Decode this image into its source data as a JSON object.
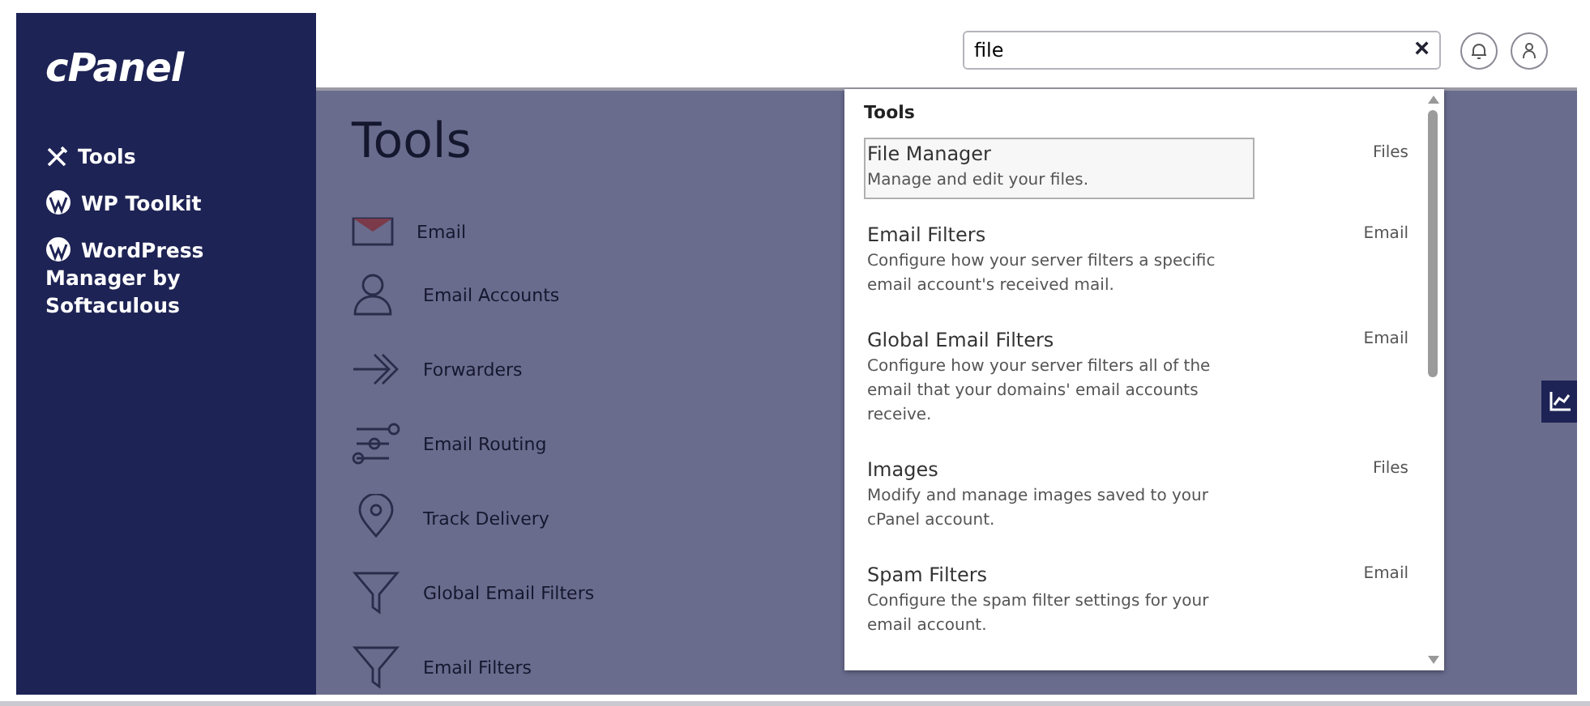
{
  "sidebar": {
    "logo": "cPanel",
    "items": [
      {
        "label": "Tools"
      },
      {
        "label": "WP Toolkit"
      },
      {
        "label": "WordPress Manager by Softaculous"
      }
    ]
  },
  "header": {
    "search": {
      "value": "file",
      "clear": "×"
    }
  },
  "page": {
    "title": "Tools",
    "tools": [
      {
        "label": "Email"
      },
      {
        "label": "Email Accounts"
      },
      {
        "label": "Forwarders"
      },
      {
        "label": "Email Routing"
      },
      {
        "label": "Track Delivery"
      },
      {
        "label": "Global Email Filters"
      },
      {
        "label": "Email Filters"
      }
    ]
  },
  "search_results": {
    "heading": "Tools",
    "items": [
      {
        "name": "File Manager",
        "description": "Manage and edit your files.",
        "category": "Files",
        "selected": true
      },
      {
        "name": "Email Filters",
        "description": "Configure how your server filters a specific email account's received mail.",
        "category": "Email",
        "selected": false
      },
      {
        "name": "Global Email Filters",
        "description": "Configure how your server filters all of the email that your domains' email accounts receive.",
        "category": "Email",
        "selected": false
      },
      {
        "name": "Images",
        "description": "Modify and manage images saved to your cPanel account.",
        "category": "Files",
        "selected": false
      },
      {
        "name": "Spam Filters",
        "description": "Configure the spam filter settings for your email account.",
        "category": "Email",
        "selected": false
      }
    ]
  }
}
